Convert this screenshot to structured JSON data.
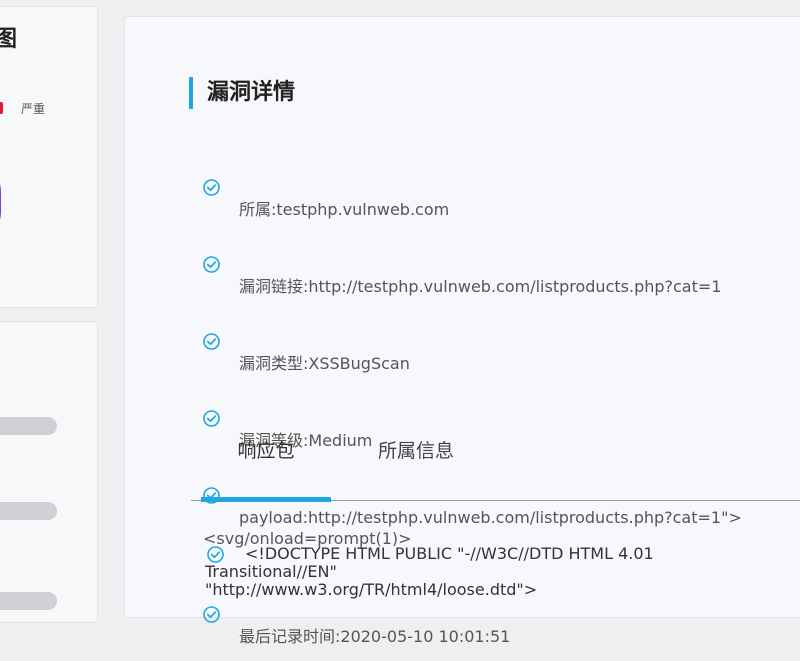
{
  "left_panel": {
    "title_fragment": "图",
    "legend_label": "严重",
    "legend_color": "#e8163c"
  },
  "main": {
    "section_title": "漏洞详情",
    "details": [
      {
        "icon": "check-circle-icon",
        "text": "所属:testphp.vulnweb.com"
      },
      {
        "icon": "check-circle-icon",
        "text": "漏洞链接:http://testphp.vulnweb.com/listproducts.php?cat=1"
      },
      {
        "icon": "check-circle-icon",
        "text": "漏洞类型:XSSBugScan"
      },
      {
        "icon": "check-circle-icon",
        "text": "漏洞等级:Medium"
      },
      {
        "icon": "check-circle-icon",
        "text": "payload:http://testphp.vulnweb.com/listproducts.php?cat=1\">\n<svg/onload=prompt(1)>"
      },
      {
        "icon": "check-circle-icon",
        "text": "最后记录时间:2020-05-10 10:01:51"
      }
    ],
    "tabs": [
      {
        "label": "响应包",
        "active": true
      },
      {
        "label": "所属信息",
        "active": false
      }
    ],
    "response_text": "<!DOCTYPE HTML PUBLIC \"-//W3C//DTD HTML 4.01\nTransitional//EN\"\n\"http://www.w3.org/TR/html4/loose.dtd\">",
    "accent_color": "#1fa7e0"
  }
}
